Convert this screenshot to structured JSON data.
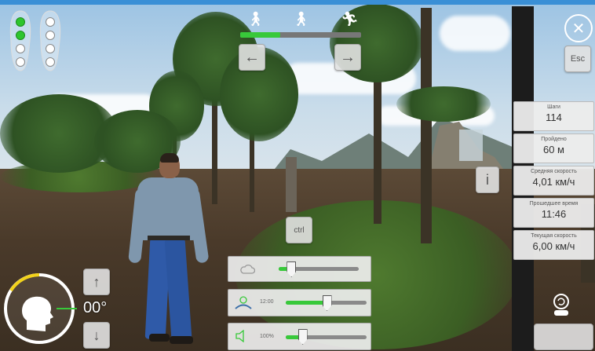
{
  "hud": {
    "footprints": {
      "left_foot": [
        true,
        true,
        false,
        false
      ],
      "right_foot": [
        false,
        false,
        false,
        false
      ]
    },
    "walk_progress": 0.33,
    "nav": {
      "prev_icon": "arrow-left-icon",
      "next_icon": "arrow-right-icon"
    },
    "close_icon": "close-circle-icon",
    "esc_label": "Esc",
    "info_label": "i",
    "ctrl_label": "ctrl",
    "stats": [
      {
        "label": "Шаги",
        "value": "114"
      },
      {
        "label": "Пройдено",
        "value": "60 м"
      },
      {
        "label": "Средняя скорость",
        "value": "4,01 км/ч"
      },
      {
        "label": "Прошедшее время",
        "value": "11:46"
      },
      {
        "label": "Текущая скорость",
        "value": "6,00 км/ч"
      }
    ],
    "sliders": {
      "weather": {
        "icon": "cloud-icon",
        "value": 0.15
      },
      "time": {
        "icon": "sun-horizon-icon",
        "text": "12:00",
        "value": 0.5
      },
      "volume": {
        "icon": "speaker-icon",
        "text": "100%",
        "value": 0.2
      }
    },
    "head_angle": "00°",
    "head_up_icon": "arrow-up-icon",
    "head_down_icon": "arrow-down-icon",
    "camera_icon": "camera-reset-icon",
    "accent_color": "#38c93a"
  }
}
